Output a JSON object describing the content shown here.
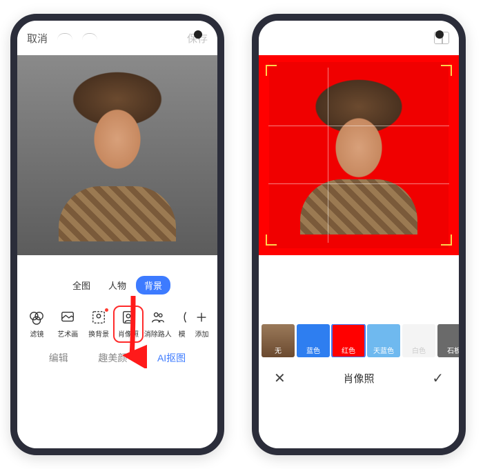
{
  "left": {
    "topbar": {
      "cancel": "取消",
      "save": "保存"
    },
    "segments": [
      {
        "label": "全图",
        "active": false
      },
      {
        "label": "人物",
        "active": false
      },
      {
        "label": "背景",
        "active": true
      }
    ],
    "tools": [
      {
        "label": "滤镜",
        "name": "filter-tool"
      },
      {
        "label": "艺术画",
        "name": "art-tool"
      },
      {
        "label": "换背景",
        "name": "change-bg-tool",
        "dot": true
      },
      {
        "label": "肖像照",
        "name": "portrait-tool",
        "highlight": true
      },
      {
        "label": "消除路人",
        "name": "remove-person-tool"
      },
      {
        "label": "模",
        "name": "blur-tool"
      },
      {
        "label": "添加",
        "name": "add-tool"
      }
    ],
    "tabs": [
      {
        "label": "编辑",
        "active": false
      },
      {
        "label": "趣美颜",
        "active": false
      },
      {
        "label": "AI抠图",
        "active": true
      }
    ]
  },
  "right": {
    "swatches": [
      {
        "label": "无",
        "name": "swatch-none",
        "bg": "thumb"
      },
      {
        "label": "蓝色",
        "name": "swatch-blue",
        "bg": "#2e7ef0"
      },
      {
        "label": "红色",
        "name": "swatch-red",
        "bg": "#ff0000",
        "selected": true
      },
      {
        "label": "天蓝色",
        "name": "swatch-skyblue",
        "bg": "#6fb9ef"
      },
      {
        "label": "白色",
        "name": "swatch-white",
        "bg": "#f4f4f4",
        "light": true
      },
      {
        "label": "石板",
        "name": "swatch-slate",
        "bg": "#6a6a6a"
      }
    ],
    "title": "肖像照"
  }
}
